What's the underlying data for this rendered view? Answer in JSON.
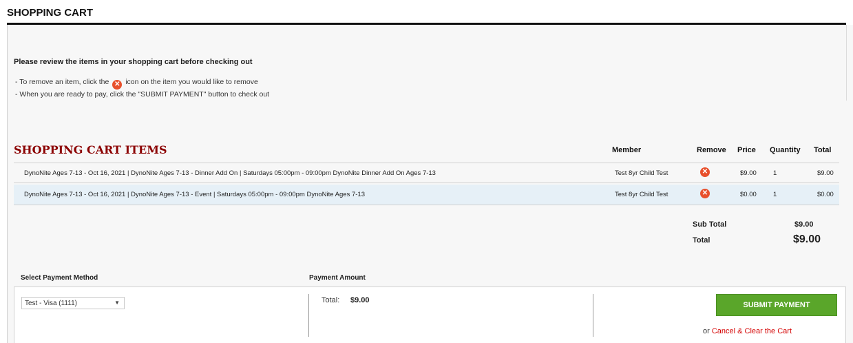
{
  "header": {
    "title": "SHOPPING CART"
  },
  "intro": {
    "text": "Please review the items in your shopping cart before checking out",
    "inst1_before": "- To remove an item, click the",
    "inst1_after": "icon on the item you would like to remove",
    "inst2": "- When you are ready to pay, click the \"SUBMIT PAYMENT\" button to check out"
  },
  "cart": {
    "title": "SHOPPING CART ITEMS",
    "columns": {
      "member": "Member",
      "remove": "Remove",
      "price": "Price",
      "quantity": "Quantity",
      "total": "Total"
    },
    "items": [
      {
        "description": "DynoNite Ages 7-13 - Oct 16, 2021 | DynoNite Ages 7-13 - Dinner Add On | Saturdays 05:00pm - 09:00pm DynoNite Dinner Add On Ages 7-13",
        "member": "Test 8yr Child Test",
        "price": "$9.00",
        "quantity": "1",
        "total": "$9.00"
      },
      {
        "description": "DynoNite Ages 7-13 - Oct 16, 2021 | DynoNite Ages 7-13 - Event | Saturdays 05:00pm - 09:00pm DynoNite Ages 7-13",
        "member": "Test 8yr Child Test",
        "price": "$0.00",
        "quantity": "1",
        "total": "$0.00"
      }
    ],
    "remove_icon": "close-circle-icon",
    "summary": {
      "subtotal_label": "Sub Total",
      "subtotal_value": "$9.00",
      "total_label": "Total",
      "total_value": "$9.00"
    }
  },
  "payment": {
    "method_label": "Select Payment Method",
    "amount_label": "Payment Amount",
    "selected_method": "Test - Visa (1111)",
    "amount_total_label": "Total:",
    "amount_total_value": "$9.00",
    "submit_label": "SUBMIT PAYMENT",
    "or_text": "or",
    "cancel_label": "Cancel & Clear the Cart"
  },
  "colors": {
    "accent_title": "#8b0000",
    "submit_green": "#5aa62a",
    "remove_orange": "#e8502c",
    "cancel_red": "#d40000",
    "row_alt": "#e6f0f7"
  }
}
